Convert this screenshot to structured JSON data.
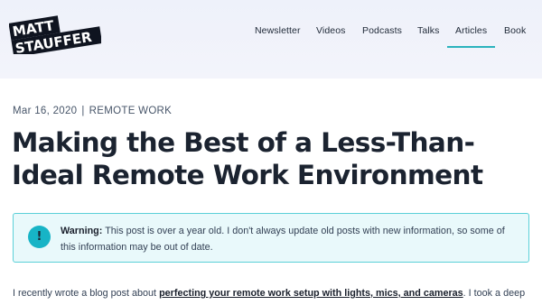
{
  "header": {
    "logo": {
      "line1": "MATT",
      "line2": "STAUFFER"
    },
    "nav": [
      {
        "label": "Newsletter",
        "active": false
      },
      {
        "label": "Videos",
        "active": false
      },
      {
        "label": "Podcasts",
        "active": false
      },
      {
        "label": "Talks",
        "active": false
      },
      {
        "label": "Articles",
        "active": true
      },
      {
        "label": "Book",
        "active": false
      }
    ],
    "accent_color": "#2bb3bd"
  },
  "post": {
    "date": "Mar 16, 2020",
    "separator": "|",
    "category": "REMOTE WORK",
    "title": "Making the Best of a Less-Than-Ideal Remote Work Environment",
    "warning": {
      "icon": "!",
      "label": "Warning:",
      "text": " This post is over a year old. I don't always update old posts with new information, so some of this information may be out of date."
    },
    "intro": {
      "before": "I recently wrote a blog post about ",
      "link": "perfecting your remote work setup with lights, mics, and cameras",
      "after": ". I took a deep"
    }
  }
}
